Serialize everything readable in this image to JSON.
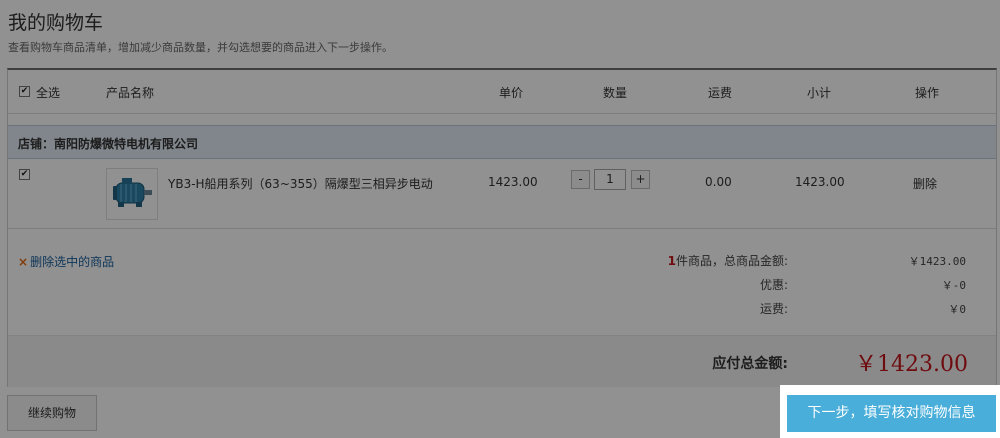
{
  "page": {
    "title": "我的购物车",
    "subtitle": "查看购物车商品清单，增加减少商品数量，并勾选想要的商品进入下一步操作。"
  },
  "table": {
    "select_all_label": "全选",
    "headers": {
      "product": "产品名称",
      "unit_price": "单价",
      "quantity": "数量",
      "shipping": "运费",
      "subtotal": "小计",
      "action": "操作"
    }
  },
  "shop": {
    "label": "店铺：南阳防爆微特电机有限公司"
  },
  "items": [
    {
      "checked": true,
      "name": "YB3-H船用系列（63~355）隔爆型三相异步电动",
      "unit_price": "1423.00",
      "quantity": "1",
      "qty_minus": "-",
      "qty_plus": "+",
      "shipping": "0.00",
      "subtotal": "1423.00",
      "delete_label": "删除"
    }
  ],
  "summary": {
    "delete_selected": "删除选中的商品",
    "delete_icon": "×",
    "item_count": "1",
    "item_count_suffix": "件商品，总商品金额:",
    "goods_total": "￥1423.00",
    "discount_label": "优惠:",
    "discount_value": "￥-0",
    "freight_label": "运费:",
    "freight_value": "￥0",
    "payable_label": "应付总金额:",
    "payable_value": "￥1423.00"
  },
  "actions": {
    "continue_shopping": "继续购物",
    "next_step": "下一步，填写核对购物信息"
  },
  "colors": {
    "next_button": "#49aeda",
    "total_price": "#c3161c",
    "shop_bar": "#e2ecf5",
    "link": "#1a5e9b",
    "item_count": "#c3161c"
  }
}
